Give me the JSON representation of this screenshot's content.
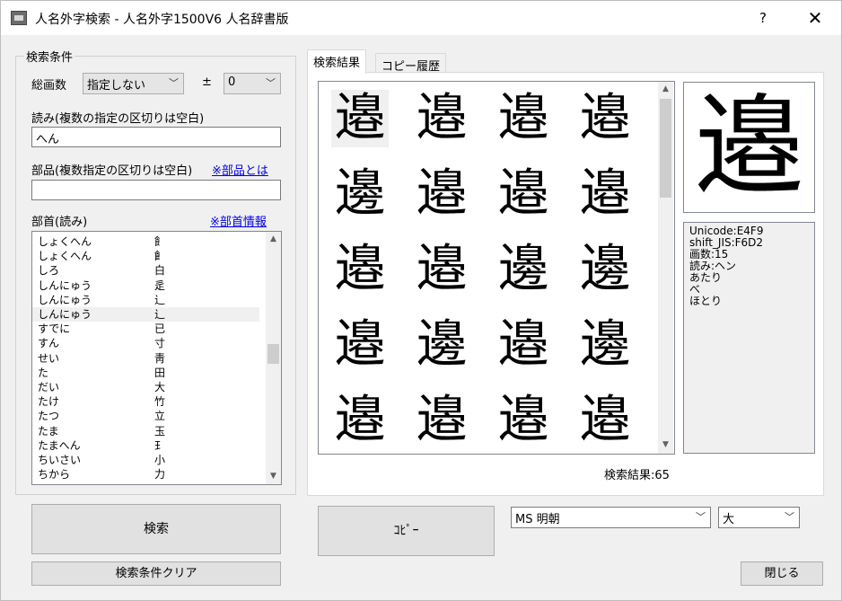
{
  "window": {
    "title": "人名外字検索 - 人名外字1500V6 人名辞書版",
    "help_label": "?",
    "close_label": "✕"
  },
  "search": {
    "group_label": "検索条件",
    "strokes_label": "総画数",
    "strokes_value": "指定しない",
    "plusminus_label": "±",
    "plusminus_value": "0",
    "reading_label": "読み(複数の指定の区切りは空白)",
    "reading_value": "へん",
    "parts_label": "部品(複数指定の区切りは空白)",
    "parts_link": "※部品とは",
    "parts_value": "",
    "radical_label": "部首(読み)",
    "radical_link": "※部首情報",
    "radicals": [
      {
        "reading": "しょくへん",
        "glyph": "飠"
      },
      {
        "reading": "しょくへん",
        "glyph": "𩙿"
      },
      {
        "reading": "しろ",
        "glyph": "白"
      },
      {
        "reading": "しんにゅう",
        "glyph": "辵"
      },
      {
        "reading": "しんにゅう",
        "glyph": "辶"
      },
      {
        "reading": "しんにゅう",
        "glyph": "⻌"
      },
      {
        "reading": "すでに",
        "glyph": "已"
      },
      {
        "reading": "すん",
        "glyph": "寸"
      },
      {
        "reading": "せい",
        "glyph": "靑"
      },
      {
        "reading": "た",
        "glyph": "田"
      },
      {
        "reading": "だい",
        "glyph": "大"
      },
      {
        "reading": "たけ",
        "glyph": "竹"
      },
      {
        "reading": "たつ",
        "glyph": "立"
      },
      {
        "reading": "たま",
        "glyph": "玉"
      },
      {
        "reading": "たまへん",
        "glyph": "𤣩"
      },
      {
        "reading": "ちいさい",
        "glyph": "小"
      },
      {
        "reading": "ちから",
        "glyph": "力"
      }
    ],
    "search_button": "検索",
    "clear_button": "検索条件クリア"
  },
  "tabs": [
    {
      "label": "検索結果"
    },
    {
      "label": "コピー履歴"
    }
  ],
  "results": {
    "glyphs": [
      "邉",
      "邉",
      "邉",
      "邉",
      "邊",
      "邉",
      "邉",
      "邉",
      "邉",
      "邉",
      "邊",
      "邊",
      "邉",
      "邊",
      "邉",
      "邊",
      "邉",
      "邉",
      "邉",
      "邉"
    ],
    "count_text": "検索結果:65"
  },
  "preview": {
    "glyph": "邉",
    "info": [
      "Unicode:E4F9",
      "shift_JIS:F6D2",
      "画数:15",
      "読み:ヘン",
      "あたり",
      "べ",
      "ほとり"
    ]
  },
  "bottom": {
    "copy_button": "ｺﾋﾟｰ",
    "font_value": "MS 明朝",
    "size_value": "大",
    "close_button": "閉じる"
  }
}
